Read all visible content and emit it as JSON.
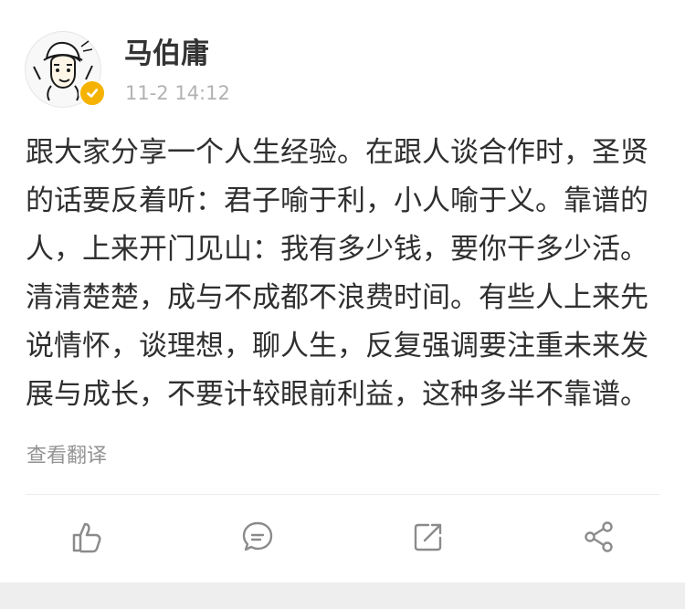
{
  "post": {
    "author": "马伯庸",
    "time": "11-2 14:12",
    "text": "跟大家分享一个人生经验。在跟人谈合作时，圣贤的话要反着听：君子喻于利，小人喻于义。靠谱的人，上来开门见山：我有多少钱，要你干多少活。清清楚楚，成与不成都不浪费时间。有些人上来先说情怀，谈理想，聊人生，反复强调要注重未来发展与成长，不要计较眼前利益，这种多半不靠谱。",
    "translate_label": "查看翻译"
  },
  "icons": {
    "avatar": "avatar-portrait",
    "verified": "verified-badge-icon",
    "like": "thumbs-up-icon",
    "comment": "comment-icon",
    "repost": "repost-icon",
    "share": "share-icon"
  },
  "colors": {
    "author": "#333333",
    "time": "#b2b2b2",
    "text": "#2f2f2f",
    "translate": "#939393",
    "verified_badge": "#f5b300",
    "icon_gray": "#8b8b8b"
  }
}
